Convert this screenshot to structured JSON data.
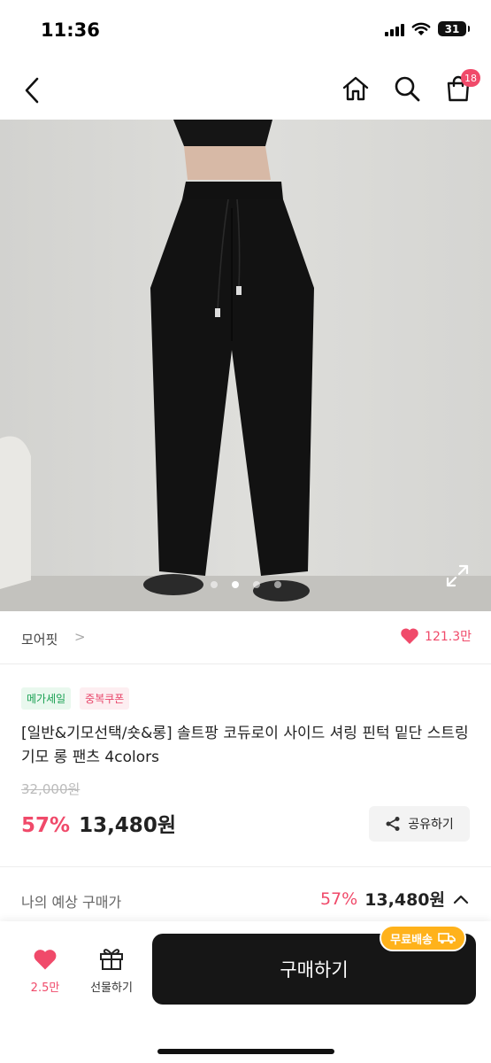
{
  "status": {
    "time": "11:36",
    "battery": "31"
  },
  "nav": {
    "cart_count": "18"
  },
  "gallery": {
    "slide_count": 4,
    "active_slide": 1
  },
  "brand": {
    "name": "모어핏",
    "chevron": ">",
    "likes": "121.3만"
  },
  "badges": [
    "메가세일",
    "중복쿠폰"
  ],
  "product": {
    "title": "[일반&기모선택/숏&롱] 솔트팡 코듀로이 사이드 셔링 핀턱 밑단 스트링 기모 롱 팬츠 4colors",
    "original_price": "32,000원",
    "discount": "57%",
    "price": "13,480원"
  },
  "share": {
    "label": "공유하기"
  },
  "estimate": {
    "label": "나의 예상 구매가",
    "discount": "57%",
    "price": "13,480원"
  },
  "bottom": {
    "like_count": "2.5만",
    "gift_label": "선물하기",
    "buy_label": "구매하기",
    "free_shipping": "무료배송"
  },
  "colors": {
    "accent": "#f04a6a",
    "buy_button": "#161616",
    "free_shipping": "#ffb21b"
  }
}
